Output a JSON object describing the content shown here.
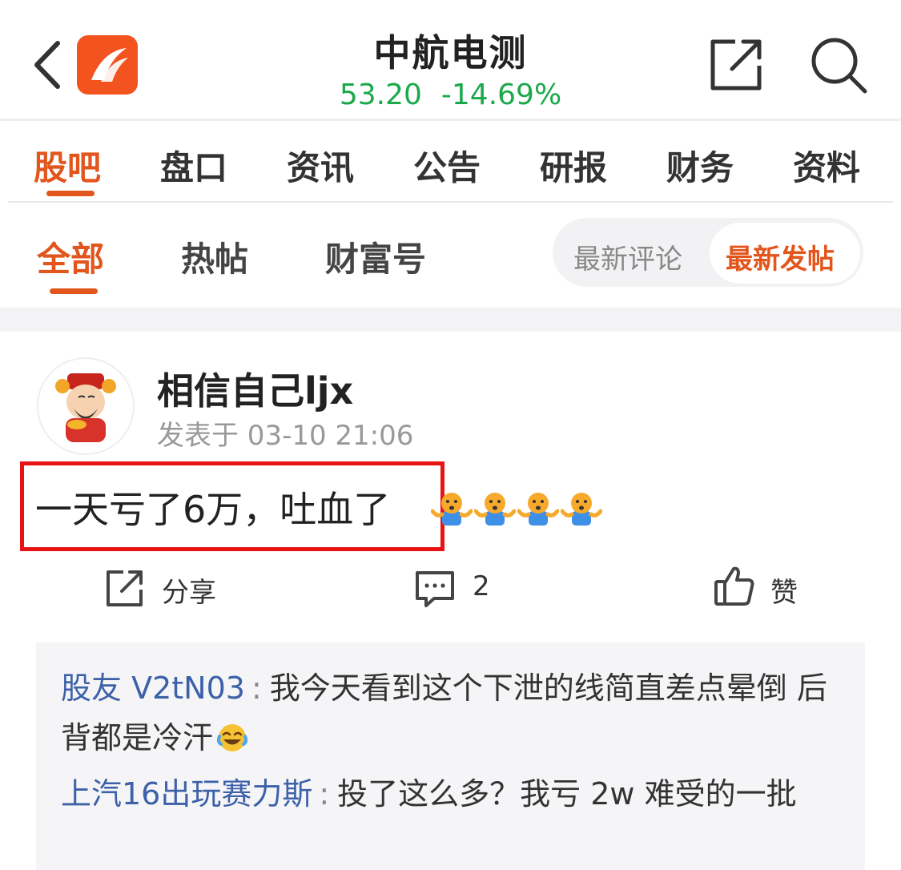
{
  "header": {
    "title": "中航电测",
    "price": "53.20",
    "change": "-14.69%",
    "colors": {
      "up_down": "#1aa94a",
      "brand": "#f2531f"
    }
  },
  "tabs": [
    {
      "label": "股吧",
      "active": true
    },
    {
      "label": "盘口"
    },
    {
      "label": "资讯"
    },
    {
      "label": "公告"
    },
    {
      "label": "研报"
    },
    {
      "label": "财务"
    },
    {
      "label": "资料"
    }
  ],
  "subtabs": [
    {
      "label": "全部",
      "active": true
    },
    {
      "label": "热帖"
    },
    {
      "label": "财富号"
    }
  ],
  "sort": {
    "latest_comment": "最新评论",
    "latest_post": "最新发帖",
    "selected": "最新发帖"
  },
  "post": {
    "author": "相信自己ljx",
    "time": "发表于 03-10 21:06",
    "text": "一天亏了6万，吐血了",
    "emoji": [
      "shrug-emoji",
      "shrug-emoji",
      "shrug-emoji",
      "shrug-emoji"
    ],
    "actions": {
      "share": "分享",
      "comments": "2",
      "like": "赞"
    }
  },
  "comments": [
    {
      "user": "股友 V2tN03",
      "text": "我今天看到这个下泄的线简直差点晕倒 后背都是冷汗"
    },
    {
      "user": "上汽16出玩赛力斯",
      "text": "投了这么多？我亏 2w 难受的一批"
    }
  ]
}
